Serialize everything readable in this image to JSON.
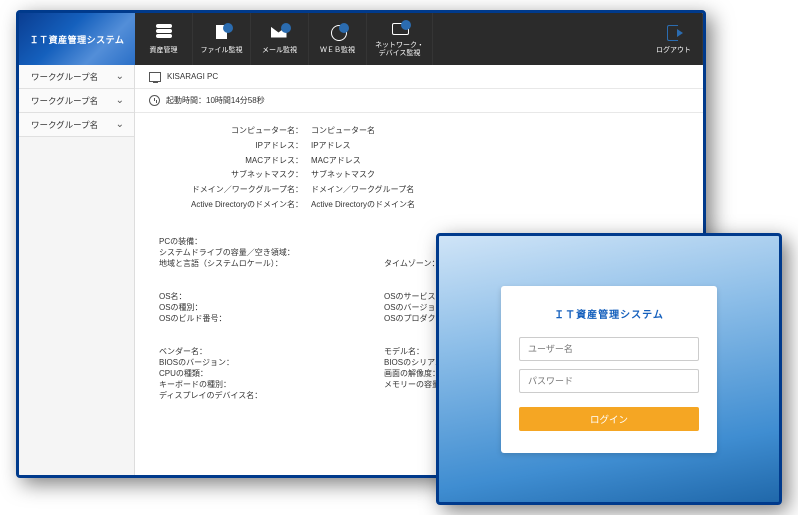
{
  "brand": "ＩＴ資産管理システム",
  "nav": {
    "assets": "資産管理",
    "file": "ファイル監視",
    "mail": "メール監視",
    "web": "ＷＥＢ監視",
    "network_l1": "ネットワーク・",
    "network_l2": "デバイス監視",
    "logout": "ログアウト"
  },
  "sidebar": {
    "item": "ワークグループ名"
  },
  "pc_name": "KISARAGI PC",
  "uptime_label": "起動時間：",
  "uptime_value": "10時間14分58秒",
  "details1": {
    "computer_k": "コンピューター名：",
    "computer_v": "コンピューター名",
    "ip_k": "IPアドレス：",
    "ip_v": "IPアドレス",
    "mac_k": "MACアドレス：",
    "mac_v": "MACアドレス",
    "subnet_k": "サブネットマスク：",
    "subnet_v": "サブネットマスク",
    "domain_k": "ドメイン／ワークグループ名：",
    "domain_v": "ドメイン／ワークグループ名",
    "ad_k": "Active Directoryのドメイン名：",
    "ad_v": "Active Directoryのドメイン名"
  },
  "details2": {
    "pc_eq": "PCの装備：",
    "sysdrive": "システムドライブの容量／空き領域：",
    "locale": "地域と言語（システムロケール）：",
    "tz": "タイムゾーン："
  },
  "details3": {
    "osname": "OS名：",
    "ostype": "OSの種別：",
    "osbuild": "OSのビルド番号：",
    "ossp": "OSのサービスパック名：",
    "osver": "OSのバージョン：",
    "osprod": "OSのプロダクトID："
  },
  "details4": {
    "vendor": "ベンダー名：",
    "model": "モデル名：",
    "biosver": "BIOSのバージョン：",
    "biossn": "BIOSのシリアル番号：",
    "cpu": "CPUの種類：",
    "resolution": "画面の解像度：",
    "kb": "キーボードの種別：",
    "memory": "メモリーの容量：",
    "display": "ディスプレイのデバイス名："
  },
  "login": {
    "title": "ＩＴ資産管理システム",
    "user_ph": "ユーザー名",
    "pwd_ph": "パスワード",
    "button": "ログイン"
  }
}
